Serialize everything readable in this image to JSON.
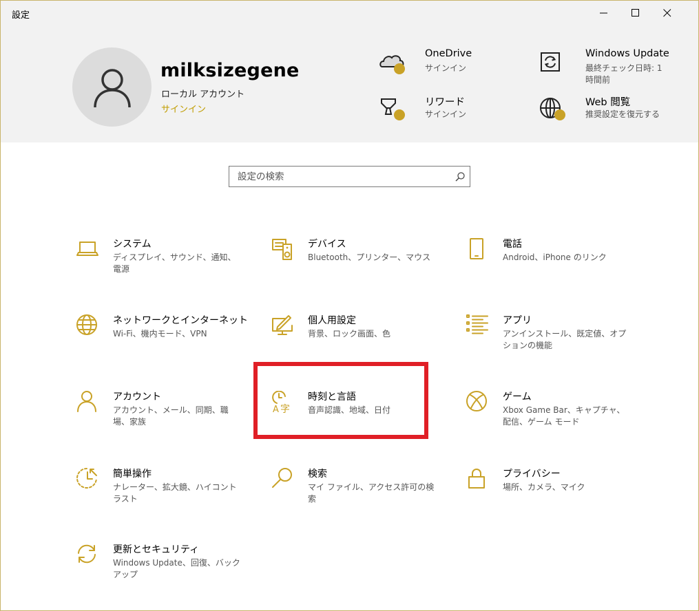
{
  "window": {
    "title": "設定"
  },
  "header": {
    "username": "milksizegene",
    "account_type": "ローカル アカウント",
    "signin_link": "サインイン",
    "items": [
      {
        "title": "OneDrive",
        "subtitle": "サインイン"
      },
      {
        "title": "Windows Update",
        "subtitle": "最終チェック日時: 1 時間前"
      },
      {
        "title": "リワード",
        "subtitle": "サインイン"
      },
      {
        "title": "Web 閲覧",
        "subtitle": "推奨設定を復元する"
      }
    ]
  },
  "search": {
    "placeholder": "設定の検索"
  },
  "categories": [
    {
      "title": "システム",
      "desc": "ディスプレイ、サウンド、通知、電源",
      "icon": "laptop-icon"
    },
    {
      "title": "デバイス",
      "desc": "Bluetooth、プリンター、マウス",
      "icon": "devices-icon"
    },
    {
      "title": "電話",
      "desc": "Android、iPhone のリンク",
      "icon": "phone-icon"
    },
    {
      "title": "ネットワークとインターネット",
      "desc": "Wi-Fi、機内モード、VPN",
      "icon": "globe-icon"
    },
    {
      "title": "個人用設定",
      "desc": "背景、ロック画面、色",
      "icon": "personalization-icon"
    },
    {
      "title": "アプリ",
      "desc": "アンインストール、既定値、オプションの機能",
      "icon": "apps-list-icon"
    },
    {
      "title": "アカウント",
      "desc": "アカウント、メール、同期、職場、家族",
      "icon": "person-icon"
    },
    {
      "title": "時刻と言語",
      "desc": "音声認識、地域、日付",
      "icon": "time-language-icon"
    },
    {
      "title": "ゲーム",
      "desc": "Xbox Game Bar、キャプチャ、配信、ゲーム モード",
      "icon": "xbox-icon"
    },
    {
      "title": "簡単操作",
      "desc": "ナレーター、拡大鏡、ハイコントラスト",
      "icon": "ease-of-access-icon"
    },
    {
      "title": "検索",
      "desc": "マイ ファイル、アクセス許可の検索",
      "icon": "search-icon"
    },
    {
      "title": "プライバシー",
      "desc": "場所、カメラ、マイク",
      "icon": "lock-icon"
    },
    {
      "title": "更新とセキュリティ",
      "desc": "Windows Update、回復、バックアップ",
      "icon": "sync-icon"
    }
  ],
  "colors": {
    "accent": "#c9a227",
    "header_bg": "#f2f2f2",
    "highlight": "#e01f26"
  }
}
